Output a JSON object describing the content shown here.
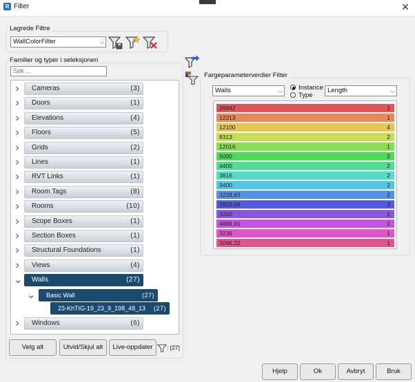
{
  "window": {
    "title": "Filter",
    "close_glyph": "✕"
  },
  "saved_filters": {
    "section_label": "Lagrede Filtre",
    "selected": "WallColorFilter",
    "icons": [
      "save-filter-icon",
      "add-filter-icon",
      "delete-filter-icon"
    ]
  },
  "families": {
    "section_label": "Familier og typer i seleksjonen",
    "search_placeholder": "Søk ...",
    "items": [
      {
        "label": "Cameras",
        "count": "(3)"
      },
      {
        "label": "Doors",
        "count": "(1)"
      },
      {
        "label": "Elevations",
        "count": "(4)"
      },
      {
        "label": "Floors",
        "count": "(5)"
      },
      {
        "label": "Grids",
        "count": "(2)"
      },
      {
        "label": "Lines",
        "count": "(1)"
      },
      {
        "label": "RVT Links",
        "count": "(1)"
      },
      {
        "label": "Room Tags",
        "count": "(8)"
      },
      {
        "label": "Rooms",
        "count": "(10)"
      },
      {
        "label": "Scope Boxes",
        "count": "(1)"
      },
      {
        "label": "Section Boxes",
        "count": "(1)"
      },
      {
        "label": "Structural Foundations",
        "count": "(1)"
      },
      {
        "label": "Views",
        "count": "(4)"
      },
      {
        "label": "Walls",
        "count": "(27)"
      },
      {
        "label": "Windows",
        "count": "(6)"
      }
    ],
    "walls_children": {
      "type_label": "Basic Wall",
      "type_count": "(27)",
      "instance_label": "23-KhTIG-19_23_9_198_48_13",
      "instance_count": "(27)"
    }
  },
  "bottom_left": {
    "select_all": "Velg alt",
    "expand_collapse": "Utvid/Skjul alt",
    "live_update": "Live-oppdater",
    "filter_count": ": [27]"
  },
  "color_filter": {
    "section_label": "Fargeparameterverdier Filter",
    "category": "Walls",
    "radio_instance": "Instance",
    "radio_type": "Type",
    "selected_mode": "Instance",
    "parameter": "Length",
    "rows": [
      {
        "value": "26842",
        "count": "2",
        "color": "#e05557"
      },
      {
        "value": "12313",
        "count": "1",
        "color": "#e8885a"
      },
      {
        "value": "12100",
        "count": "4",
        "color": "#e4c554"
      },
      {
        "value": "8313",
        "count": "2",
        "color": "#c8dd55"
      },
      {
        "value": "12016",
        "count": "1",
        "color": "#8bdc55"
      },
      {
        "value": "5000",
        "count": "2",
        "color": "#4fdb5a"
      },
      {
        "value": "4400",
        "count": "2",
        "color": "#52dc91"
      },
      {
        "value": "3816",
        "count": "2",
        "color": "#54dcc7"
      },
      {
        "value": "3400",
        "count": "2",
        "color": "#55c6e2"
      },
      {
        "value": "3228,63",
        "count": "2",
        "color": "#5592e2"
      },
      {
        "value": "2803,04",
        "count": "2",
        "color": "#5558e0"
      },
      {
        "value": "3200",
        "count": "1",
        "color": "#8a55e0"
      },
      {
        "value": "4888,91",
        "count": "2",
        "color": "#c555e0"
      },
      {
        "value": "3236",
        "count": "1",
        "color": "#e055c7"
      },
      {
        "value": "3066,22",
        "count": "1",
        "color": "#e0558e"
      }
    ]
  },
  "footer": {
    "help": "Hjelp",
    "ok": "Ok",
    "cancel": "Avbryt",
    "apply": "Bruk"
  }
}
